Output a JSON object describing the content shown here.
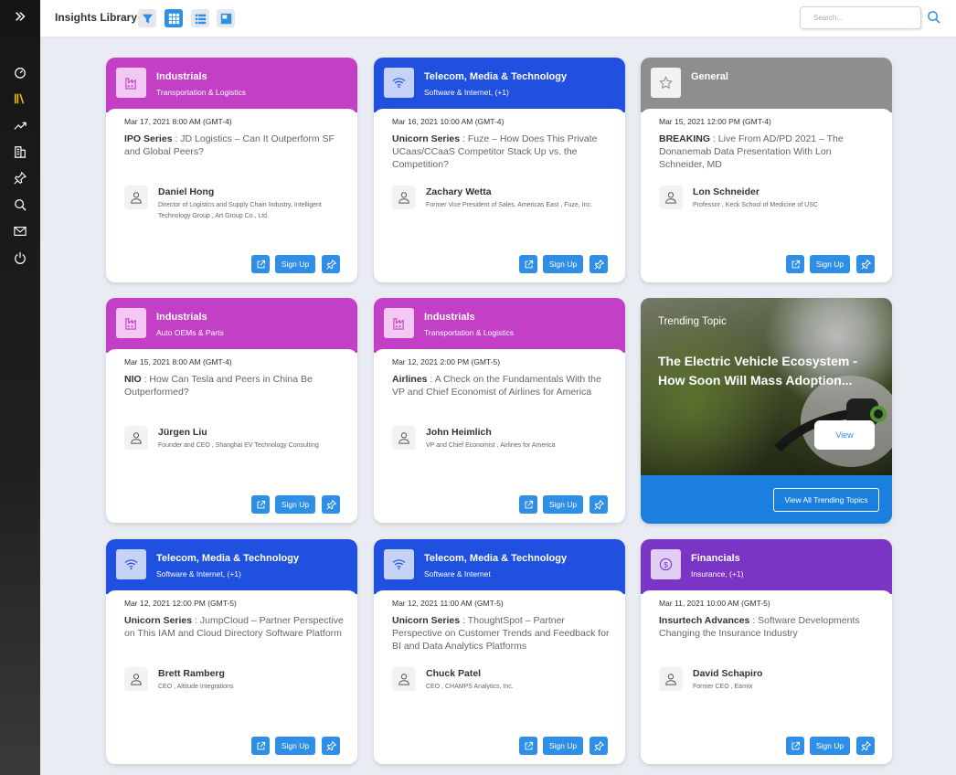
{
  "header": {
    "title": "Insights Library",
    "search_placeholder": "Search..."
  },
  "colors": {
    "magenta": "#c23fc6",
    "blue": "#1f50df",
    "gray": "#8e8e8e",
    "purple": "#7b35c6",
    "accent": "#2f8fe6"
  },
  "actions": {
    "signup_label": "Sign Up"
  },
  "cards": [
    {
      "head_color": "magenta",
      "icon": "industrial-building-icon",
      "category": "Industrials",
      "subcategory": "Transportation & Logistics",
      "date": "Mar 17, 2021 8:00 AM (GMT-4)",
      "series": "IPO Series",
      "topic": " : JD Logistics – Can It Outperform SF and Global Peers?",
      "person": "Daniel Hong",
      "role": "Director of Logistics and Supply Chain Industry, Intelligent Technology Group , Art Group Co., Ltd."
    },
    {
      "head_color": "blue",
      "icon": "wifi-icon",
      "category": "Telecom, Media & Technology",
      "subcategory": "Software & Internet, (+1)",
      "date": "Mar 16, 2021 10:00 AM (GMT-4)",
      "series": "Unicorn Series",
      "topic": " : Fuze – How Does This Private UCaas/CCaaS Competitor Stack Up vs. the Competition?",
      "person": "Zachary Wetta",
      "role": "Former Vice President of Sales, Americas East , Fuze, Inc."
    },
    {
      "head_color": "gray",
      "icon": "star-icon",
      "category": "General",
      "subcategory": "",
      "date": "Mar 15, 2021 12:00 PM (GMT-4)",
      "series": "BREAKING",
      "topic": " : Live From AD/PD 2021 – The Donanemab Data Presentation With Lon Schneider, MD",
      "person": "Lon Schneider",
      "role": "Professor , Keck School of Medicine of USC"
    },
    {
      "head_color": "magenta",
      "icon": "industrial-building-icon",
      "category": "Industrials",
      "subcategory": "Auto OEMs & Parts",
      "date": "Mar 15, 2021 8:00 AM (GMT-4)",
      "series": "NIO",
      "topic": " : How Can Tesla and Peers in China Be Outperformed?",
      "person": "Jürgen Liu",
      "role": "Founder and CEO , Shanghai EV Technology Consulting"
    },
    {
      "head_color": "magenta",
      "icon": "industrial-building-icon",
      "category": "Industrials",
      "subcategory": "Transportation & Logistics",
      "date": "Mar 12, 2021 2:00 PM (GMT-5)",
      "series": "Airlines",
      "topic": " : A Check on the Fundamentals With the VP and Chief Economist of Airlines for America",
      "person": "John Heimlich",
      "role": "VP and Chief Economist , Airlines for America"
    },
    {
      "head_color": "blue",
      "icon": "wifi-icon",
      "category": "Telecom, Media & Technology",
      "subcategory": "Software & Internet, (+1)",
      "date": "Mar 12, 2021 12:00 PM (GMT-5)",
      "series": "Unicorn Series",
      "topic": " : JumpCloud – Partner Perspective on This IAM and Cloud Directory Software Platform",
      "person": "Brett Ramberg",
      "role": "CEO , Altitude Integrations"
    },
    {
      "head_color": "blue",
      "icon": "wifi-icon",
      "category": "Telecom, Media & Technology",
      "subcategory": "Software & Internet",
      "date": "Mar 12, 2021 11:00 AM (GMT-5)",
      "series": "Unicorn Series",
      "topic": " : ThoughtSpot – Partner Perspective on Customer Trends and Feedback for BI and Data Analytics Platforms",
      "person": "Chuck Patel",
      "role": "CEO , CHAMPS Analytics, Inc."
    },
    {
      "head_color": "purple",
      "icon": "dollar-icon",
      "category": "Financials",
      "subcategory": "Insurance, (+1)",
      "date": "Mar 11, 2021 10:00 AM (GMT-5)",
      "series": "Insurtech Advances",
      "topic": " : Software Developments Changing the Insurance Industry",
      "person": "David Schapiro",
      "role": "Former CEO , Earnix"
    }
  ],
  "trending": {
    "label": "Trending Topic",
    "title": "The Electric Vehicle Ecosystem - How Soon Will Mass Adoption...",
    "view_label": "View",
    "view_all_label": "View All Trending Topics"
  }
}
